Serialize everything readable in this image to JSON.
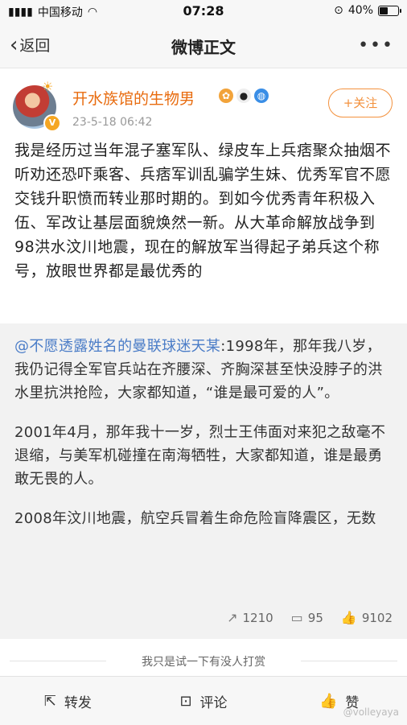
{
  "status_bar": {
    "carrier": "中国移动",
    "time": "07:28",
    "battery": "40%"
  },
  "nav": {
    "back_label": "返回",
    "title": "微博正文",
    "more": "•••"
  },
  "author": {
    "name": "开水族馆的生物男",
    "time": "23-5-18 06:42",
    "follow_label": "+关注"
  },
  "post": {
    "text": "我是经历过当年混子塞军队、绿皮车上兵痞聚众抽烟不听劝还恐吓乘客、兵痞军训乱骗学生妹、优秀军官不愿交钱升职愤而转业那时期的。到如今优秀青年积极入伍、军改让基层面貌焕然一新。从大革命解放战争到98洪水汶川地震，现在的解放军当得起子弟兵这个称号，放眼世界都是最优秀的"
  },
  "repost": {
    "mention": "@不愿透露姓名的曼联球迷天某",
    "para1": ":1998年，那年我八岁，我仍记得全军官兵站在齐腰深、齐胸深甚至快没脖子的洪水里抗洪抢险，大家都知道，“谁是最可爱的人”。",
    "para2": "2001年4月，那年我十一岁，烈士王伟面对来犯之敌毫不退缩，与美军机碰撞在南海牺牲，大家都知道，谁是最勇敢无畏的人。",
    "para3": "2008年汶川地震，航空兵冒着生命危险盲降震区，无数",
    "stats": {
      "reposts": "1210",
      "comments": "95",
      "likes": "9102"
    }
  },
  "reward_text": "我只是试一下有没人打赏",
  "toolbar": {
    "repost": "转发",
    "comment": "评论",
    "like": "赞"
  },
  "watermark": "@volleyaya",
  "icons": {
    "signal": "signal-icon",
    "wifi": "wifi-icon",
    "lock": "orientation-lock-icon",
    "back": "chevron-left-icon",
    "more": "more-icon",
    "repost": "share-icon",
    "comment": "comment-icon",
    "like": "thumbs-up-icon"
  },
  "colors": {
    "accent": "#f3913d",
    "username": "#e86b0e",
    "mention": "#4a7cc7"
  }
}
